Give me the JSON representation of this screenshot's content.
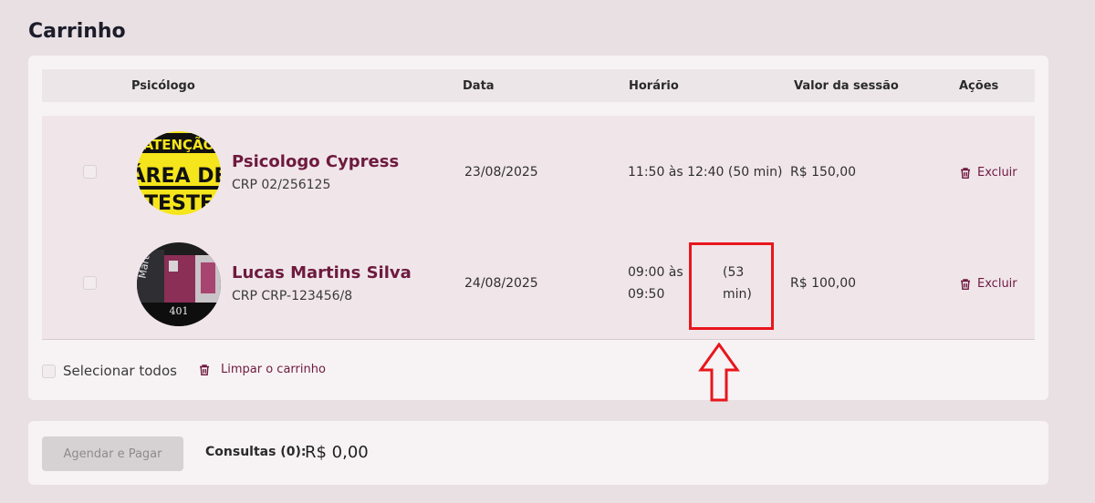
{
  "page": {
    "title": "Carrinho"
  },
  "table": {
    "headers": {
      "psicologo": "Psicólogo",
      "data": "Data",
      "horario": "Horário",
      "valor": "Valor da sessão",
      "acoes": "Ações"
    },
    "rows": [
      {
        "name": "Psicologo Cypress",
        "crp": "CRP 02/256125",
        "date": "23/08/2025",
        "time": "11:50 às 12:40 (50 min)",
        "price": "R$ 150,00",
        "action": "Excluir",
        "avatar_text": [
          "ATENÇÃO",
          "ÁREA DE",
          "TESTE"
        ]
      },
      {
        "name": "Lucas Martins Silva",
        "crp": "CRP CRP-123456/8",
        "date": "24/08/2025",
        "time_line1": "09:00 às",
        "time_line2": "09:50",
        "duration_line1": "(53",
        "duration_line2": "min)",
        "price": "R$ 100,00",
        "action": "Excluir",
        "avatar_text": [
          "Mart",
          "401"
        ]
      }
    ]
  },
  "footer": {
    "select_all": "Selecionar todos",
    "clear_cart": "Limpar o carrinho"
  },
  "checkout": {
    "button": "Agendar e Pagar",
    "consultas_label": "Consultas (0):",
    "total": "R$ 0,00"
  },
  "colors": {
    "accent": "#6e1a3e",
    "annotation": "#e8161d",
    "background": "#e8e0e3"
  }
}
